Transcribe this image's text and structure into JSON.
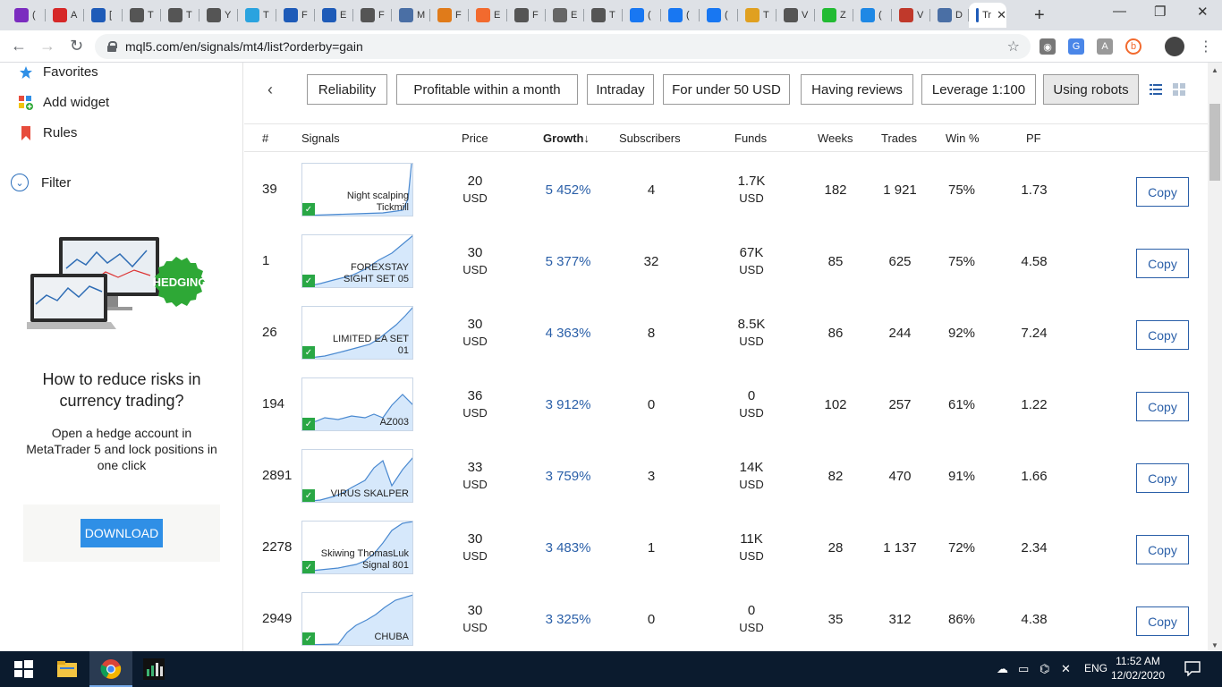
{
  "browser": {
    "tabs": [
      {
        "letter": "(",
        "color": "#7b2cbf",
        "icon": "mail-icon"
      },
      {
        "letter": "A",
        "color": "#d62828",
        "icon": "fx-icon"
      },
      {
        "letter": "[",
        "color": "#1e5bb8",
        "icon": "cart-icon"
      },
      {
        "letter": "T",
        "color": "#555555",
        "icon": "globe-icon"
      },
      {
        "letter": "T",
        "color": "#555555",
        "icon": "globe-icon"
      },
      {
        "letter": "Y",
        "color": "#555555",
        "icon": "globe-icon"
      },
      {
        "letter": "T",
        "color": "#2aa3df",
        "icon": "telegram-icon"
      },
      {
        "letter": "F",
        "color": "#1e5bb8",
        "icon": "cart-icon"
      },
      {
        "letter": "E",
        "color": "#1e5bb8",
        "icon": "cart-icon"
      },
      {
        "letter": "F",
        "color": "#555555",
        "icon": "globe-icon"
      },
      {
        "letter": "M",
        "color": "#4a6fa5",
        "icon": "cap-icon"
      },
      {
        "letter": "F",
        "color": "#e07b1a",
        "icon": "fx-icon"
      },
      {
        "letter": "E",
        "color": "#f26a2e",
        "icon": "bitcoin-icon"
      },
      {
        "letter": "F",
        "color": "#555555",
        "icon": "globe-icon"
      },
      {
        "letter": "E",
        "color": "#666666",
        "icon": "sd-icon"
      },
      {
        "letter": "T",
        "color": "#555555",
        "icon": "globe-icon"
      },
      {
        "letter": "(",
        "color": "#1877f2",
        "icon": "facebook-icon"
      },
      {
        "letter": "(",
        "color": "#1877f2",
        "icon": "facebook-icon"
      },
      {
        "letter": "(",
        "color": "#1877f2",
        "icon": "facebook-icon"
      },
      {
        "letter": "T",
        "color": "#e0a020",
        "icon": "pizza-icon"
      },
      {
        "letter": "V",
        "color": "#555555",
        "icon": "globe-icon"
      },
      {
        "letter": "Z",
        "color": "#22bb33",
        "icon": "dot-icon"
      },
      {
        "letter": "(",
        "color": "#1e88e5",
        "icon": "og-icon"
      },
      {
        "letter": "V",
        "color": "#c0392b",
        "icon": "tv-icon"
      },
      {
        "letter": "D",
        "color": "#4a6fa5",
        "icon": "cap-icon"
      },
      {
        "letter": "Tr",
        "color": "#1e5bb8",
        "icon": "mql-icon",
        "active": true
      }
    ],
    "url": "mql5.com/en/signals/mt4/list?orderby=gain"
  },
  "sidebar": {
    "items": [
      {
        "label": "Favorites",
        "icon": "star-icon",
        "color": "#2f8fe6"
      },
      {
        "label": "Add widget",
        "icon": "widget-icon",
        "color": "#e74c3c"
      },
      {
        "label": "Rules",
        "icon": "bookmark-icon",
        "color": "#e74c3c"
      }
    ],
    "filter_label": "Filter",
    "promo": {
      "badge": "HEDGING",
      "title": "How to reduce risks in currency trading?",
      "text": "Open a hedge account in MetaTrader 5 and lock positions in one click",
      "button": "DOWNLOAD",
      "badge_color": "#2ea836",
      "button_color": "#2f8fe6"
    }
  },
  "filters": [
    {
      "label": "Reliability",
      "active": false
    },
    {
      "label": "Profitable within a month",
      "active": false
    },
    {
      "label": "Intraday",
      "active": false
    },
    {
      "label": "For under 50 USD",
      "active": false
    },
    {
      "label": "Having reviews",
      "active": false
    },
    {
      "label": "Leverage 1:100",
      "active": false
    },
    {
      "label": "Using robots",
      "active": true
    }
  ],
  "table": {
    "headers": {
      "num": "#",
      "signals": "Signals",
      "price": "Price",
      "growth": "Growth",
      "growth_arrow": "↓",
      "subscribers": "Subscribers",
      "funds": "Funds",
      "weeks": "Weeks",
      "trades": "Trades",
      "win": "Win %",
      "pf": "PF"
    },
    "currency": "USD",
    "copy_label": "Copy",
    "rows": [
      {
        "num": "39",
        "name": "Night scalping Tickmill",
        "price": "20",
        "growth": "5 452%",
        "subs": "4",
        "funds": "1.7K",
        "weeks": "182",
        "trades": "1 921",
        "win": "75%",
        "pf": "1.73"
      },
      {
        "num": "1",
        "name": "FOREXSTAY SIGHT SET 05",
        "price": "30",
        "growth": "5 377%",
        "subs": "32",
        "funds": "67K",
        "weeks": "85",
        "trades": "625",
        "win": "75%",
        "pf": "4.58"
      },
      {
        "num": "26",
        "name": "LIMITED EA SET 01",
        "price": "30",
        "growth": "4 363%",
        "subs": "8",
        "funds": "8.5K",
        "weeks": "86",
        "trades": "244",
        "win": "92%",
        "pf": "7.24"
      },
      {
        "num": "194",
        "name": "AZ003",
        "price": "36",
        "growth": "3 912%",
        "subs": "0",
        "funds": "0",
        "weeks": "102",
        "trades": "257",
        "win": "61%",
        "pf": "1.22"
      },
      {
        "num": "2891",
        "name": "VIRUS SKALPER",
        "price": "33",
        "growth": "3 759%",
        "subs": "3",
        "funds": "14K",
        "weeks": "82",
        "trades": "470",
        "win": "91%",
        "pf": "1.66"
      },
      {
        "num": "2278",
        "name": "Skiwing ThomasLuk Signal 801",
        "price": "30",
        "growth": "3 483%",
        "subs": "1",
        "funds": "11K",
        "weeks": "28",
        "trades": "1 137",
        "win": "72%",
        "pf": "2.34"
      },
      {
        "num": "2949",
        "name": "CHUBA",
        "price": "30",
        "growth": "3 325%",
        "subs": "0",
        "funds": "0",
        "weeks": "35",
        "trades": "312",
        "win": "86%",
        "pf": "4.38"
      }
    ]
  },
  "taskbar": {
    "time": "11:52 AM",
    "date": "12/02/2020",
    "lang": "ENG"
  },
  "colors": {
    "link": "#2a5fa8",
    "tabbar": "#dee1e6",
    "taskbar": "#0b1b2e"
  }
}
